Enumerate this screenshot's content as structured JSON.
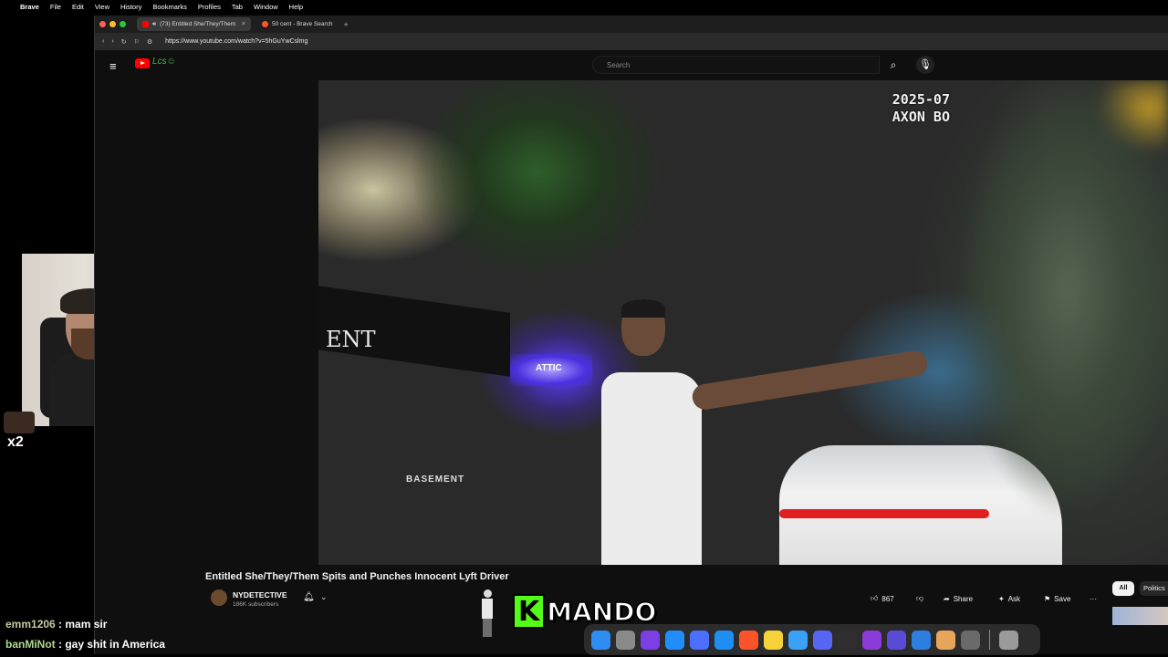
{
  "menubar": {
    "apple": "",
    "app": "Brave",
    "items": [
      "File",
      "Edit",
      "View",
      "History",
      "Bookmarks",
      "Profiles",
      "Tab",
      "Window",
      "Help"
    ]
  },
  "browser": {
    "tabs": [
      {
        "label": "(73) Entitled She/They/Them",
        "close": "×",
        "active": true
      },
      {
        "label": "50 cent - Brave Search",
        "active": false
      }
    ],
    "new_tab": "+",
    "url": "https://www.youtube.com/watch?v=5hGuYwCslmg"
  },
  "youtube": {
    "search_placeholder": "Search",
    "doodle": "Lcs☺",
    "video_overlay": {
      "stamp_line1": "2025-07",
      "stamp_line2": "AXON BO",
      "sign_left": "ENT",
      "sign_neon": "ATTIC",
      "sign_basement": "BASEMENT"
    },
    "video_title": "Entitled She/They/Them Spits and Punches Innocent Lyft Driver",
    "channel": {
      "name": "NYDETECTIVE",
      "subscribers": "186K subscribers"
    },
    "actions": {
      "likes": "867",
      "share": "Share",
      "ask": "Ask",
      "save": "Save",
      "more": "···"
    },
    "chips": [
      "All",
      "Politics"
    ]
  },
  "stream": {
    "emote_count": "x2",
    "chat": [
      {
        "user": "emm1206",
        "sep": " : ",
        "message": "mam sir"
      },
      {
        "user": "banMiNot",
        "sep": " : ",
        "message": "gay shit in America"
      }
    ],
    "logo_k": "K",
    "logo_rest": "MANDO"
  },
  "dock": {
    "icons": [
      {
        "name": "finder-icon",
        "color": "#2f8cf0"
      },
      {
        "name": "launchpad-icon",
        "color": "#8a8a8a"
      },
      {
        "name": "vpn-shield-icon",
        "color": "#7b3fe4"
      },
      {
        "name": "app-store-icon",
        "color": "#1f8efa"
      },
      {
        "name": "arc-browser-icon",
        "color": "#4c6fff"
      },
      {
        "name": "safari-icon",
        "color": "#1d8ff3"
      },
      {
        "name": "brave-icon",
        "color": "#fb542b"
      },
      {
        "name": "notes-icon",
        "color": "#f5d23a"
      },
      {
        "name": "mail-icon",
        "color": "#3ba0f7"
      },
      {
        "name": "discord-icon",
        "color": "#5865f2"
      },
      {
        "name": "obs-icon",
        "color": "#302e31"
      },
      {
        "name": "iew-app-icon",
        "color": "#8b3bd8"
      },
      {
        "name": "grid-app-icon",
        "color": "#5a4bd6"
      },
      {
        "name": "finder-alt-icon",
        "color": "#2c7fe0"
      },
      {
        "name": "package-icon",
        "color": "#e6a55a"
      },
      {
        "name": "settings-icon",
        "color": "#6a6a6a"
      },
      {
        "name": "trash-icon",
        "color": "#9a9a9a"
      }
    ]
  }
}
